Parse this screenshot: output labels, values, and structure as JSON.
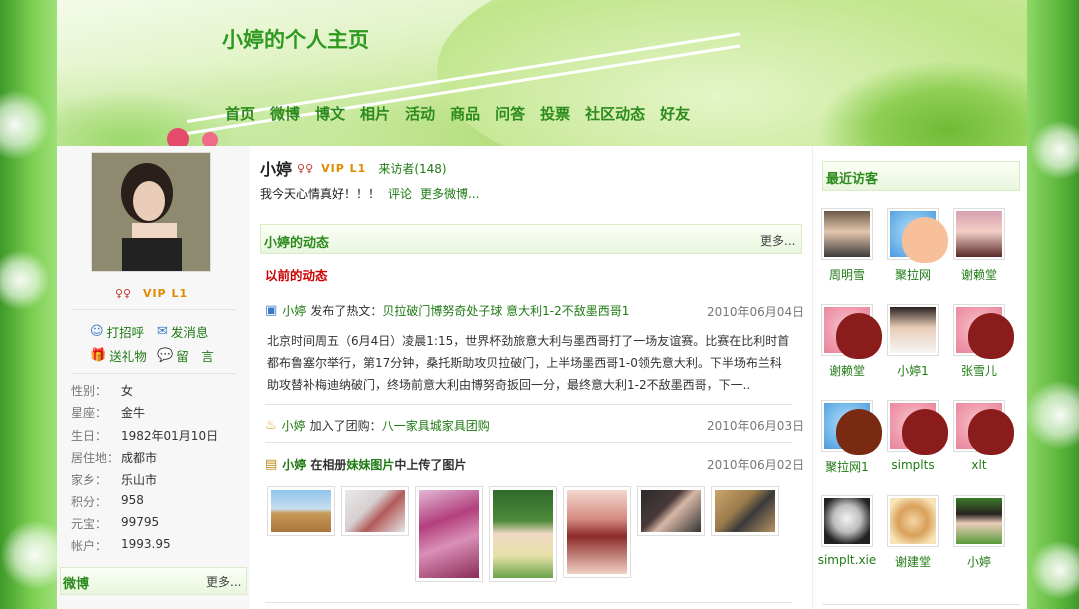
{
  "header": {
    "title": "小婷的个人主页",
    "nav": [
      "首页",
      "微博",
      "博文",
      "相片",
      "活动",
      "商品",
      "问答",
      "投票",
      "社区动态",
      "好友"
    ]
  },
  "profile": {
    "vip_text": "VIP L1",
    "actions": {
      "greet": "打招呼",
      "message": "发消息",
      "gift": "送礼物",
      "leave_message": "留　言"
    },
    "info": [
      {
        "k": "性别：",
        "v": "女"
      },
      {
        "k": "星座：",
        "v": "金牛"
      },
      {
        "k": "生日：",
        "v": "1982年01月10日"
      },
      {
        "k": "居住地：",
        "v": "成都市"
      },
      {
        "k": "家乡：",
        "v": "乐山市"
      },
      {
        "k": "积分：",
        "v": "958"
      },
      {
        "k": "元宝：",
        "v": "99795"
      },
      {
        "k": "帐户：",
        "v": "1993.95"
      }
    ],
    "weibo_box": {
      "title": "微博",
      "more": "更多..."
    }
  },
  "main": {
    "name": "小婷",
    "vip_text": "VIP L1",
    "visitors_link": "来访者(148)",
    "status": "我今天心情真好！！！",
    "comment_link": "评论",
    "more_weibo_link": "更多微博...",
    "feed_box": {
      "title": "小婷的动态",
      "more": "更多..."
    },
    "past_label": "以前的动态",
    "feed": [
      {
        "user": "小婷",
        "action": "发布了热文：",
        "target": "贝拉破门博努奇处子球 意大利1-2不敌墨西哥1",
        "date": "2010年06月04日",
        "summary": "北京时间周五（6月4日）凌晨1:15，世界杯劲旅意大利与墨西哥打了一场友谊赛。比赛在比利时首都布鲁塞尔举行，第17分钟，桑托斯助攻贝拉破门，上半场墨西哥1-0领先意大利。下半场布兰科助攻替补梅迪纳破门，终场前意大利由博努奇扳回一分，最终意大利1-2不敌墨西哥，下一.."
      },
      {
        "user": "小婷",
        "action": "加入了团购：",
        "target": "八一家具城家具团购",
        "date": "2010年06月03日"
      },
      {
        "user": "小婷",
        "action_a": "在相册",
        "album": "妹妹图片",
        "action_b": "中上传了图片",
        "date": "2010年06月02日"
      }
    ]
  },
  "sidebar": {
    "title": "最近访客",
    "visitors": [
      "周明雪",
      "聚拉网",
      "谢赖堂",
      "谢赖堂",
      "小婷1",
      "张雪儿",
      "聚拉网1",
      "simplts",
      "xlt",
      "simplt.xie",
      "谢建堂",
      "小婷"
    ]
  }
}
